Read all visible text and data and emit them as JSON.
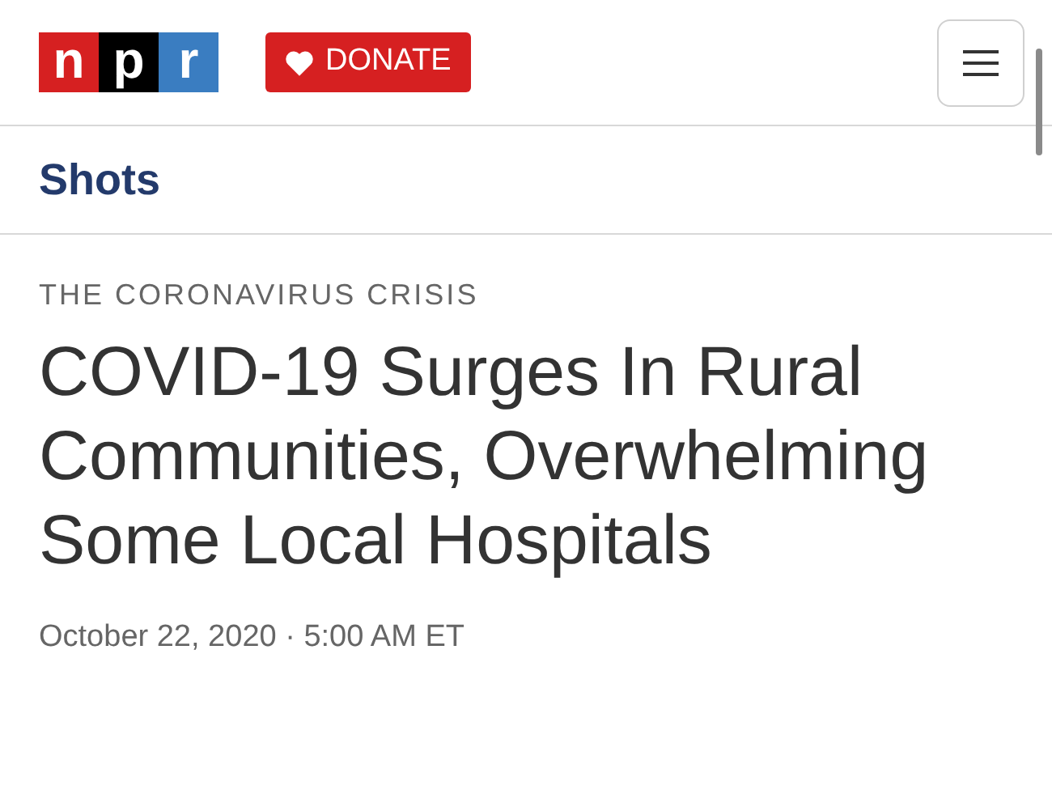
{
  "header": {
    "logo": [
      {
        "letter": "n",
        "color": "#d62021"
      },
      {
        "letter": "p",
        "color": "#000000"
      },
      {
        "letter": "r",
        "color": "#3a7dc1"
      }
    ],
    "donate_button": "DONATE"
  },
  "section": {
    "title": "Shots"
  },
  "article": {
    "kicker": "THE CORONAVIRUS CRISIS",
    "headline": "COVID-19 Surges In Rural Communities, Overwhelming Some Local Hospitals",
    "date": "October 22, 2020 · 5:00 AM ET"
  }
}
